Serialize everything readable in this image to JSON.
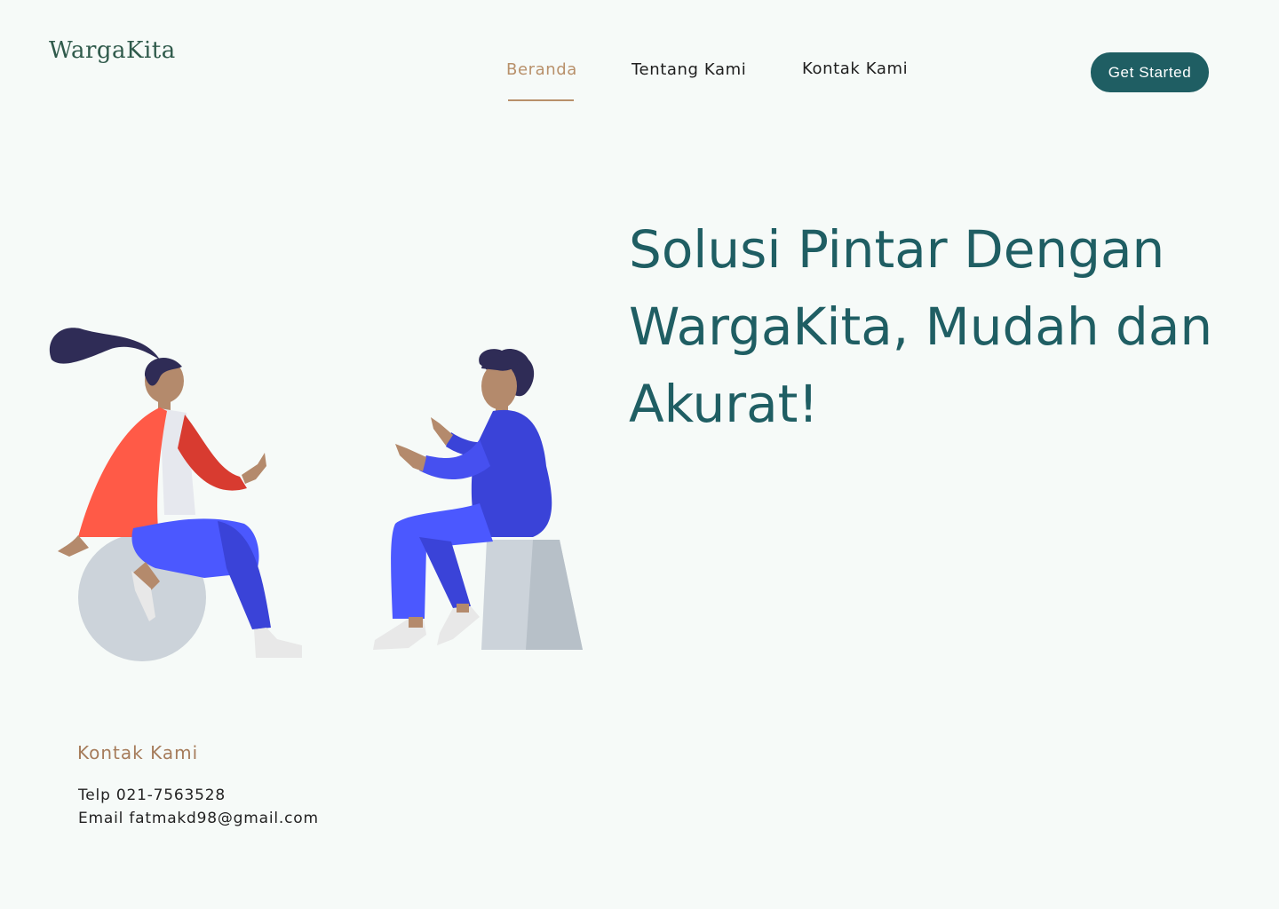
{
  "header": {
    "logo": "WargaKita",
    "nav": [
      {
        "label": "Beranda",
        "active": true
      },
      {
        "label": "Tentang Kami",
        "active": false
      },
      {
        "label": "Kontak Kami",
        "active": false
      }
    ],
    "cta_label": "Get Started"
  },
  "hero": {
    "title": "Solusi Pintar Dengan WargaKita, Mudah dan Akurat!"
  },
  "contact": {
    "heading": "Kontak Kami",
    "phone": "Telp 021-7563528",
    "email": "Email fatmakd98@gmail.com"
  },
  "colors": {
    "accent": "#1f5e63",
    "nav_active": "#b8906a",
    "background": "#f6faf8"
  }
}
